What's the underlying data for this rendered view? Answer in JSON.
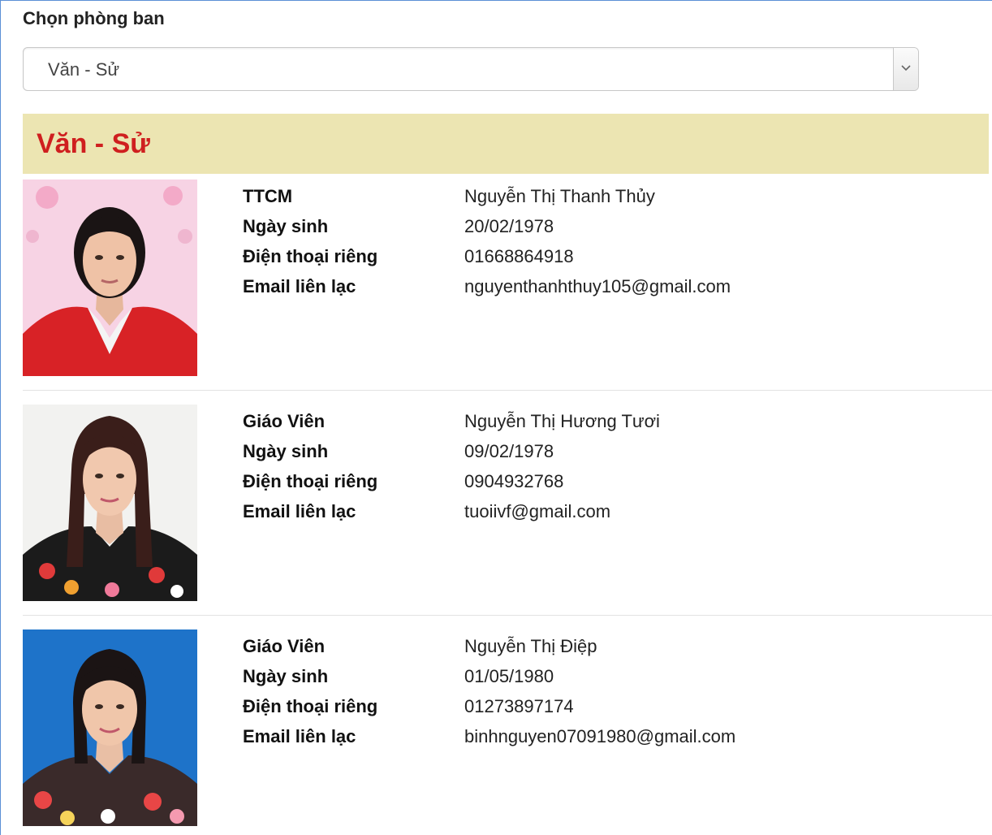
{
  "select": {
    "label": "Chọn phòng ban",
    "selected_value": "Văn - Sử",
    "arrow_icon": "chevron-down-icon"
  },
  "department": {
    "title": "Văn - Sử"
  },
  "colors": {
    "header_bg": "#ece5b2",
    "title_red": "#cf1f1f",
    "frame_blue": "#5b8fd6"
  },
  "people": [
    {
      "role": "TTCM",
      "name": "Nguyễn Thị Thanh Thủy",
      "birth_label": "Ngày sinh",
      "birth": "20/02/1978",
      "phone_label": "Điện thoại riêng",
      "phone": "01668864918",
      "email_label": "Email liên lạc",
      "email": "nguyenthanhthuy105@gmail.com"
    },
    {
      "role": "Giáo Viên",
      "name": "Nguyễn Thị Hương Tươi",
      "birth_label": "Ngày sinh",
      "birth": "09/02/1978",
      "phone_label": "Điện thoại riêng",
      "phone": "0904932768",
      "email_label": "Email liên lạc",
      "email": "tuoiivf@gmail.com"
    },
    {
      "role": "Giáo Viên",
      "name": "Nguyễn Thị Điệp",
      "birth_label": "Ngày sinh",
      "birth": "01/05/1980",
      "phone_label": "Điện thoại riêng",
      "phone": "01273897174",
      "email_label": "Email liên lạc",
      "email": "binhnguyen07091980@gmail.com"
    }
  ]
}
